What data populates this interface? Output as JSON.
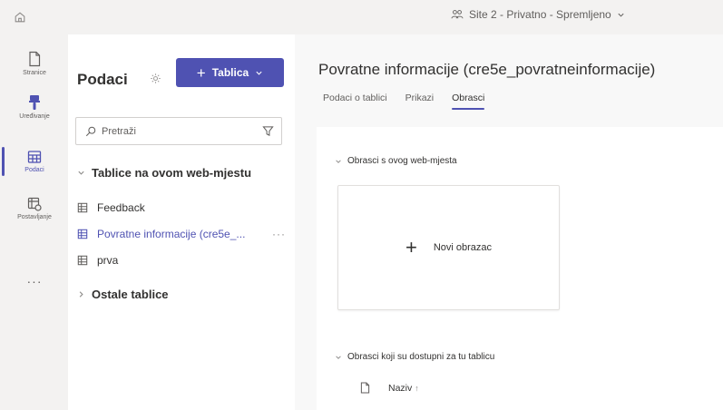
{
  "topbar": {
    "site_label": "Site 2 - Privatno - Spremljeno"
  },
  "rail": {
    "items": [
      {
        "label": "Stranice",
        "icon": "page-icon"
      },
      {
        "label": "Uređivanje",
        "icon": "brush-icon"
      },
      {
        "label": "Podaci",
        "icon": "table-icon"
      },
      {
        "label": "Postavljanje",
        "icon": "setup-icon"
      }
    ],
    "more": "···"
  },
  "left_panel": {
    "title": "Podaci",
    "new_table_label": "Tablica",
    "search_placeholder": "Pretraži",
    "section_this_site": "Tablice na ovom web-mjestu",
    "tables": [
      {
        "label": "Feedback",
        "selected": false
      },
      {
        "label": "Povratne informacije (cre5e_...",
        "selected": true
      },
      {
        "label": "prva",
        "selected": false
      }
    ],
    "more_options": "···",
    "section_other": "Ostale tablice"
  },
  "main": {
    "title": "Povratne informacije (cre5e_povratneinformacije)",
    "tabs": [
      {
        "label": "Podaci o tablici",
        "active": false
      },
      {
        "label": "Prikazi",
        "active": false
      },
      {
        "label": "Obrasci",
        "active": true
      }
    ],
    "section_site_forms": "Obrasci s ovog web-mjesta",
    "new_form_label": "Novi obrazac",
    "section_available_forms": "Obrasci koji su dostupni za tu tablicu",
    "column_name": "Naziv",
    "sort_indicator": "↑"
  },
  "colors": {
    "accent": "#4f52b2",
    "background": "#f3f2f1",
    "panel": "#ffffff",
    "text": "#323130"
  }
}
